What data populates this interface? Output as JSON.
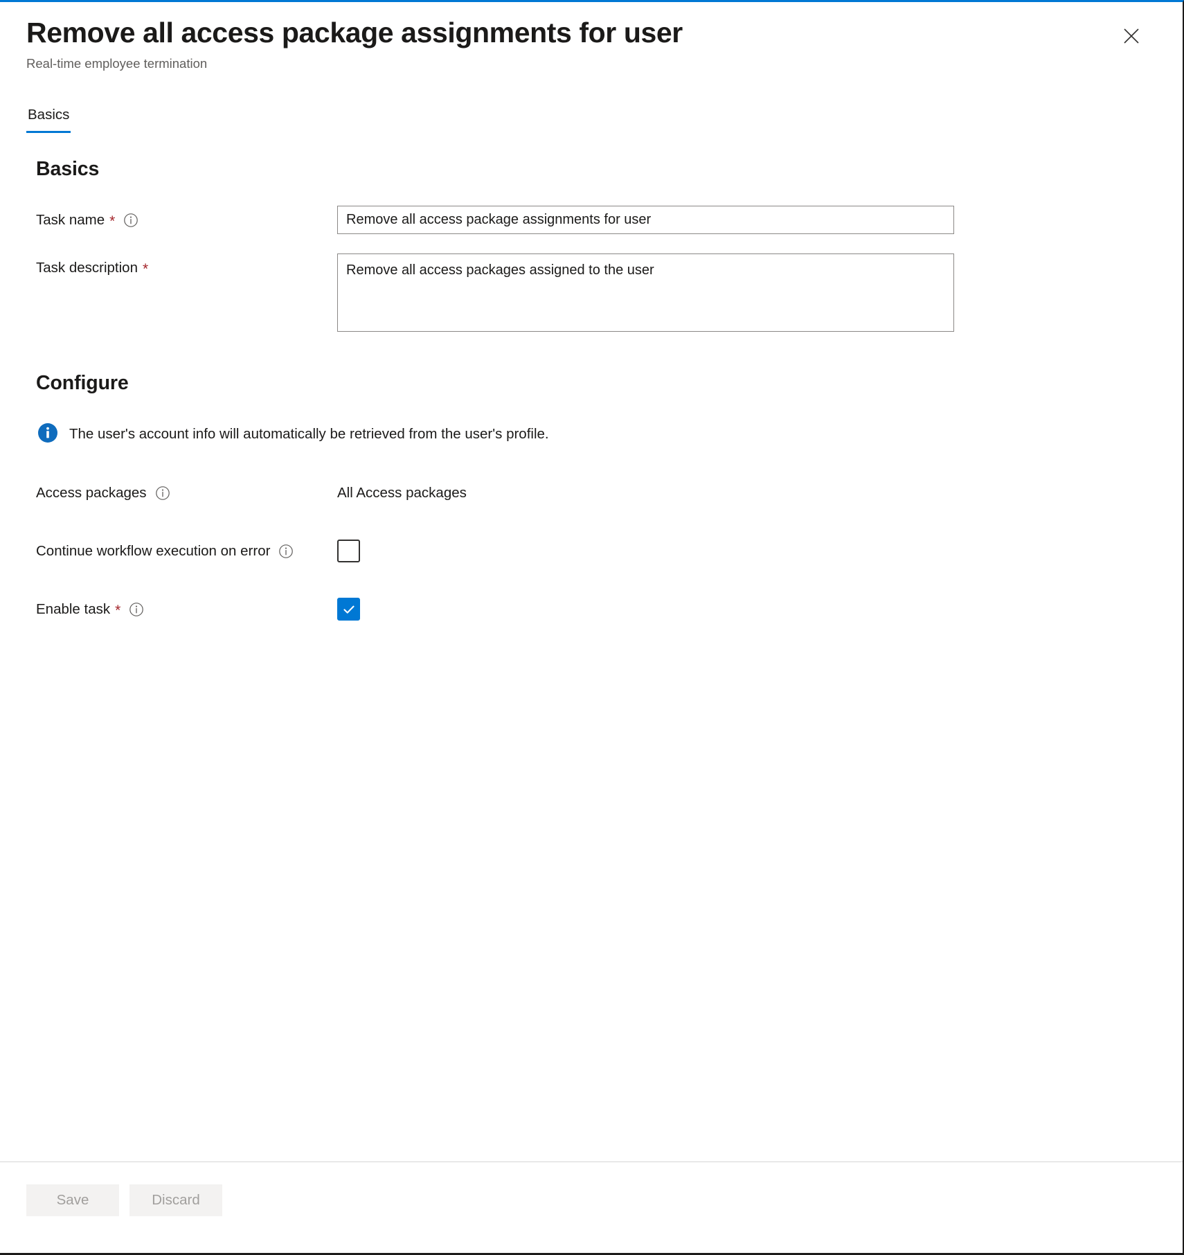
{
  "blade": {
    "title": "Remove all access package assignments for user",
    "subtitle": "Real-time employee termination",
    "close_label": "Close",
    "accent_color": "#0078d4"
  },
  "tabs": [
    {
      "label": "Basics",
      "active": true
    }
  ],
  "basics": {
    "heading": "Basics",
    "task_name": {
      "label": "Task name",
      "required_marker": "*",
      "value": "Remove all access package assignments for user",
      "placeholder": "",
      "info_icon": "info-circle-outline-icon"
    },
    "task_description": {
      "label": "Task description",
      "required_marker": "*",
      "value": "Remove all access packages assigned to the user",
      "placeholder": ""
    }
  },
  "configure": {
    "heading": "Configure",
    "info_message": {
      "icon": "info-circle-filled-icon",
      "text": "The user's account info will automatically be retrieved from the user's profile.",
      "icon_color": "#0f6cbd"
    },
    "access_packages": {
      "label": "Access packages",
      "value": "All Access packages",
      "info_icon": "info-circle-outline-icon"
    },
    "continue_on_error": {
      "label": "Continue workflow execution on error",
      "checked": false,
      "info_icon": "info-circle-outline-icon"
    },
    "enable_task": {
      "label": "Enable task",
      "required_marker": "*",
      "checked": true,
      "info_icon": "info-circle-outline-icon"
    }
  },
  "footer": {
    "save_label": "Save",
    "discard_label": "Discard",
    "save_disabled": true,
    "discard_disabled": true
  }
}
